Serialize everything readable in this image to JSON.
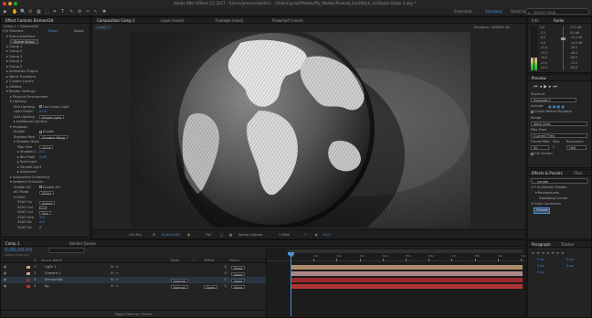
{
  "window": {
    "title": "Adobe After Effects CC 2017 - /Users/jeremendar/Dro... /VideoCopilot/Models/My_Models/PixeLab_EarthPack_v1/Stylize Globe 3.aep *"
  },
  "toolbar": {
    "tools": [
      "▶",
      "✋",
      "🔍",
      "⟲",
      "▦",
      "⬚",
      "✒",
      "T",
      "✎",
      "⚙",
      "✂",
      "↖",
      "✱"
    ],
    "workspaces": [
      {
        "label": "Essentials",
        "active": false
      },
      {
        "label": "Standard",
        "active": true
      },
      {
        "label": "Small Screen",
        "active": false
      }
    ],
    "search_placeholder": "Search Help"
  },
  "effect_controls": {
    "tab": "Effect Controls Element3d",
    "breadcrumb": "Comp 1 • Element3d",
    "rows": [
      {
        "indent": 0,
        "text": "▾ fx  Element",
        "right": "Reset",
        "blue_right": true,
        "extra": "About"
      },
      {
        "indent": 1,
        "text": "▾ Scene Interface"
      },
      {
        "indent": 2,
        "button": "Scene Setup"
      },
      {
        "indent": 1,
        "text": "▸ Group 1"
      },
      {
        "indent": 1,
        "text": "▸ Group 2"
      },
      {
        "indent": 1,
        "text": "▸ Group 3"
      },
      {
        "indent": 1,
        "text": "▸ Group 4"
      },
      {
        "indent": 1,
        "text": "▸ Group 5"
      },
      {
        "indent": 1,
        "text": "▸ Animation Engine"
      },
      {
        "indent": 1,
        "text": "▸ World Transform"
      },
      {
        "indent": 1,
        "text": "▸ Custom Layers"
      },
      {
        "indent": 1,
        "text": "▸ Utilities"
      },
      {
        "indent": 1,
        "text": "▾ Render Settings"
      },
      {
        "indent": 2,
        "text": "▸ Physical Environment"
      },
      {
        "indent": 2,
        "text": "▾ Lighting"
      },
      {
        "indent": 3,
        "text": "Add Lighting",
        "check": "Use Comp Light"
      },
      {
        "indent": 3,
        "text": "Light Falloff",
        "blue": "0.00"
      },
      {
        "indent": 3,
        "text": "Add Lighting",
        "dropdown": "Single Light"
      },
      {
        "indent": 3,
        "text": "▸ Additional Lighting"
      },
      {
        "indent": 2,
        "text": "▾ Shadows"
      },
      {
        "indent": 3,
        "text": "Enable",
        "check": "Enable"
      },
      {
        "indent": 3,
        "text": "Shadow Mod",
        "dropdown": "Shadow Mapp"
      },
      {
        "indent": 3,
        "text": "▾ Shadow Maps"
      },
      {
        "indent": 4,
        "text": "Map Size",
        "dropdown": "1024"
      },
      {
        "indent": 4,
        "text": "▸ Shadow C",
        "blue": "0.0"
      },
      {
        "indent": 4,
        "text": "▸ Blur Radi",
        "blue": "0.80"
      },
      {
        "indent": 4,
        "text": "▸ Spot Light"
      },
      {
        "indent": 4,
        "text": "▸ Parallel Light"
      },
      {
        "indent": 4,
        "text": "▸ Advanced"
      },
      {
        "indent": 2,
        "text": "▸ Subsurface Scattering"
      },
      {
        "indent": 2,
        "text": "▾ Ambient Occlusion"
      },
      {
        "indent": 3,
        "text": "Enable AO",
        "check": "Enable AO"
      },
      {
        "indent": 3,
        "text": "AO Mode",
        "dropdown": "SSAO"
      },
      {
        "indent": 3,
        "text": "▾ SSAO"
      },
      {
        "indent": 4,
        "text": "SSAO Qu",
        "dropdown": "Select"
      },
      {
        "indent": 4,
        "text": "SSAO Col",
        "swatch": true
      },
      {
        "indent": 4,
        "text": "SSAO Col",
        "dropdown": "Tint"
      },
      {
        "indent": 4,
        "text": "SSAO Inte",
        "blue": "1.0"
      },
      {
        "indent": 4,
        "text": "SSAO Ra",
        "blue": "0.0"
      },
      {
        "indent": 4,
        "text": "SSAO Sa",
        "blue": "8"
      }
    ]
  },
  "comp_panel": {
    "tabs": [
      {
        "label": "Composition Comp 1",
        "active": true
      },
      {
        "label": "Layer (none)",
        "active": false
      },
      {
        "label": "Footage (none)",
        "active": false
      },
      {
        "label": "Flowchart (none)",
        "active": false
      }
    ],
    "sub_tab": "Comp 1",
    "renderer_label": "Renderer:",
    "renderer": "CINEMA 4D",
    "footer": {
      "zoom": "(59.4%)",
      "timecode": "0;00;00;00",
      "resolution": "Full",
      "camera": "Active Camera",
      "views": "1 View",
      "exposure": "+0.0"
    }
  },
  "info_panel": {
    "tabs": [
      "Info",
      "Audio"
    ],
    "db_left": [
      "0.0",
      "-3.0",
      "-6.0",
      "-9.0",
      "-12.0",
      "-15.0",
      "-18.0",
      "-21.0",
      "-24.0"
    ],
    "db_right": [
      "12.0 dB",
      "0.0 dB",
      "-12.0 dB",
      "-24.0 dB",
      "-36.0",
      "-48.0",
      "-60.0",
      "-72.0",
      "-84.0"
    ]
  },
  "preview_panel": {
    "title": "Preview",
    "shortcut_label": "Shortcut",
    "shortcut_value": "Numpad 0",
    "include_label": "Include:",
    "cache_label": "Cache Before Playback",
    "range_label": "Range",
    "range_value": "Work Area",
    "play_from_label": "Play From",
    "play_from_value": "Current Time",
    "frame_rate_label": "Frame Rate",
    "skip_label": "Skip",
    "resolution_label": "Resolution",
    "frame_rate_value": "30",
    "skip_value": "0",
    "resolution_value": "Half",
    "full_screen_label": "Full Screen"
  },
  "effects_presets": {
    "tabs": [
      "Effects & Presets",
      "Char"
    ],
    "search_value": "curves",
    "items": [
      {
        "indent": 0,
        "text": "▾ * Animation Presets"
      },
      {
        "indent": 1,
        "text": "▾ Backgrounds"
      },
      {
        "indent": 2,
        "text": "Sweeping Curves"
      },
      {
        "indent": 0,
        "text": "▾ Color Correction"
      },
      {
        "indent": 1,
        "text": "Curves",
        "selected": true
      }
    ]
  },
  "paragraph_panel": {
    "tabs": [
      "Paragraph",
      "Tracker"
    ],
    "values": [
      "0 px",
      "0 px",
      "0 px",
      "0 px",
      "0 px"
    ]
  },
  "timeline": {
    "tabs": [
      {
        "label": "Comp 1",
        "active": true
      },
      {
        "label": "Render Queue",
        "active": false
      }
    ],
    "timecode": "0;00;00;00",
    "fps_note": "00000 (30.00 fps)",
    "columns": [
      "#",
      "Source Name",
      "Mode",
      "T",
      "TrkMat",
      "Parent"
    ],
    "layers": [
      {
        "num": "1",
        "name": "Light 1",
        "color": "#c7a07a",
        "mode": "",
        "trkmat": "",
        "parent": "None"
      },
      {
        "num": "2",
        "name": "Camera 1",
        "color": "#c79a9a",
        "mode": "",
        "trkmat": "",
        "parent": "None"
      },
      {
        "num": "3",
        "name": "Element3d",
        "color": "#9a2a2a",
        "mode": "Normal",
        "trkmat": "",
        "parent": "None"
      },
      {
        "num": "4",
        "name": "bg",
        "color": "#b33333",
        "mode": "Normal",
        "trkmat": "None",
        "parent": "None"
      }
    ],
    "ruler": [
      "0s",
      "01s",
      "02s",
      "03s",
      "04s",
      "05s",
      "06s",
      "07s",
      "08s",
      "09s",
      "10s"
    ],
    "footer": "Toggle Switches / Modes"
  }
}
